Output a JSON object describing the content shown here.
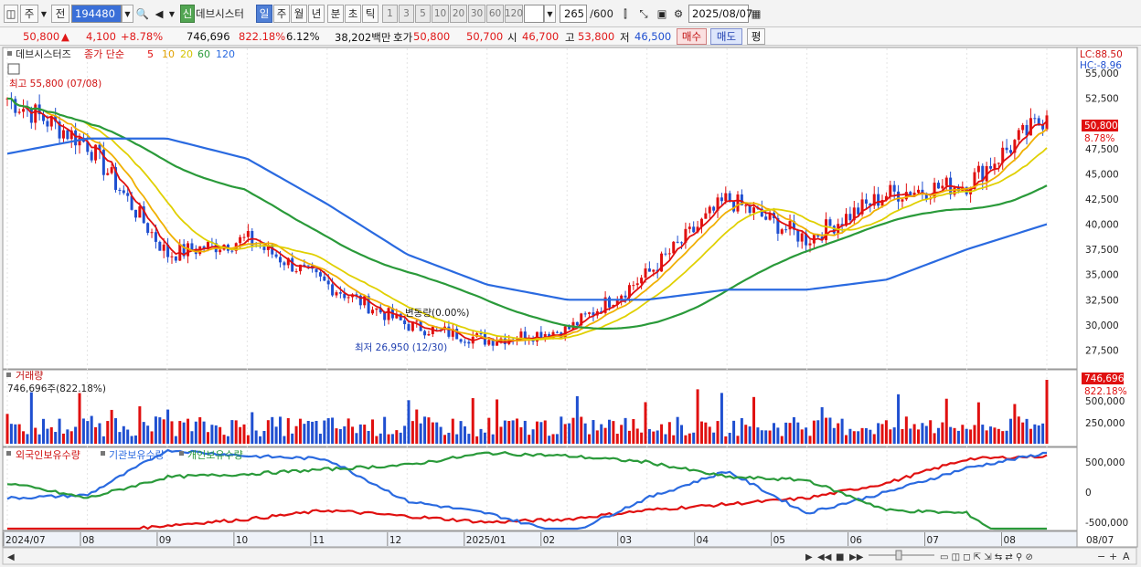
{
  "toolbar": {
    "market": "주",
    "prev": "전",
    "code": "194480",
    "stock_badge": "신",
    "stock_name": "데브시스터",
    "period_day": "일",
    "period_week": "주",
    "period_month": "월",
    "period_year": "년",
    "period_min": "분",
    "period_sec": "초",
    "period_tick": "틱",
    "intervals": [
      "1",
      "3",
      "5",
      "10",
      "20",
      "30",
      "60",
      "120"
    ],
    "count": "265",
    "count_total": "/600",
    "date": "2025/08/07"
  },
  "quote": {
    "price": "50,800",
    "change_arrow": "▲",
    "change": "4,100",
    "change_pct": "+8.78%",
    "volume": "746,696",
    "volume_pct": "822.18%",
    "turnover": "6.12%",
    "amount": "38,202백만",
    "bid_label": "호가",
    "bid": "50,800",
    "ask": "50,700",
    "open_label": "시",
    "open": "46,700",
    "high_label": "고",
    "high": "53,800",
    "low_label": "저",
    "low": "46,500",
    "buy": "매수",
    "sell": "매도",
    "avg": "평"
  },
  "legend": {
    "name": "데브시스터즈",
    "ma_label": "종가 단순",
    "ma": [
      "5",
      "10",
      "20",
      "60",
      "120"
    ],
    "ma_colors": [
      "#e01010",
      "#f0b000",
      "#e0d000",
      "#2a9a3a",
      "#2a6ae0"
    ]
  },
  "annotations": {
    "high": "최고 55,800 (07/08)",
    "low": "최저 26,950 (12/30)",
    "mid": "변동량(0.00%)"
  },
  "right_axis": {
    "lc": "LC:88.50",
    "hc": "HC:-8.96",
    "price_label": "50,800",
    "price_pct": "8.78%",
    "price_ticks": [
      "55,000",
      "52,500",
      "50,000",
      "47,500",
      "45,000",
      "42,500",
      "40,000",
      "37,500",
      "35,000",
      "32,500",
      "30,000",
      "27,500"
    ],
    "vol_label": "746,696",
    "vol_pct": "822.18%",
    "vol_ticks": [
      "500,000",
      "250,000"
    ],
    "hold_ticks": [
      "500,000",
      "0",
      "-500,000"
    ],
    "date_label": "08/07"
  },
  "volume_panel": {
    "title": "거래량",
    "value": "746,696주(822.18%)"
  },
  "holding_panel": {
    "foreign": "외국인보유수량",
    "institution": "기관보유수량",
    "individual": "개인보유수량",
    "colors": [
      "#e01010",
      "#2a6ae0",
      "#2a9a3a"
    ]
  },
  "x_labels": [
    "2024/07",
    "08",
    "09",
    "10",
    "11",
    "12",
    "2025/01",
    "02",
    "03",
    "04",
    "05",
    "06",
    "07",
    "08"
  ],
  "chart_data": {
    "type": "line",
    "x_categories": [
      "2024/07",
      "08",
      "09",
      "10",
      "11",
      "12",
      "2025/01",
      "02",
      "03",
      "04",
      "05",
      "06",
      "07",
      "08"
    ],
    "price_close": [
      52500,
      48000,
      37000,
      38500,
      34000,
      30000,
      28500,
      29500,
      35000,
      42500,
      38500,
      43000,
      44000,
      50800
    ],
    "ma120": [
      47000,
      48500,
      48500,
      46500,
      42000,
      37000,
      34000,
      32500,
      32500,
      33500,
      33500,
      34500,
      37500,
      40000
    ],
    "price_high": 55800,
    "price_low": 26950,
    "last_price": 50800,
    "last_volume": 746696,
    "ylim": [
      26000,
      57000
    ]
  }
}
